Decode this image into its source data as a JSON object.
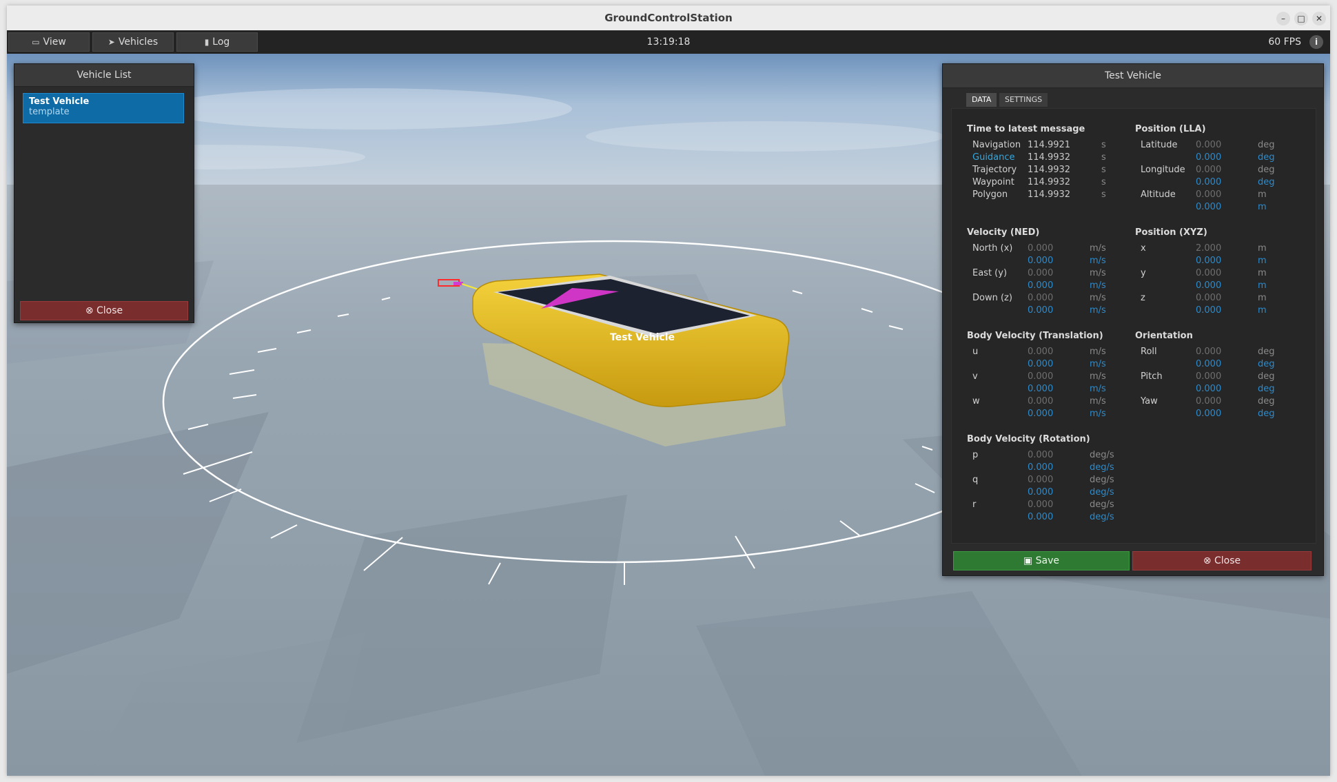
{
  "window": {
    "title": "GroundControlStation"
  },
  "menubar": {
    "view_label": "View",
    "vehicles_label": "Vehicles",
    "log_label": "Log",
    "clock": "13:19:18",
    "fps": "60 FPS"
  },
  "scene": {
    "vehicle_label": "Test Vehicle"
  },
  "vehicle_list": {
    "title": "Vehicle List",
    "items": [
      {
        "name": "Test Vehicle",
        "type": "template"
      }
    ],
    "close_label": "Close"
  },
  "vehicle_panel": {
    "title": "Test Vehicle",
    "tabs": [
      {
        "label": "DATA",
        "active": true
      },
      {
        "label": "SETTINGS",
        "active": false
      }
    ],
    "save_label": "Save",
    "close_label": "Close",
    "latest_message": {
      "title": "Time to latest message",
      "rows": [
        {
          "label": "Navigation",
          "value": "114.9921",
          "unit": "s"
        },
        {
          "label": "Guidance",
          "value": "114.9932",
          "unit": "s"
        },
        {
          "label": "Trajectory",
          "value": "114.9932",
          "unit": "s"
        },
        {
          "label": "Waypoint",
          "value": "114.9932",
          "unit": "s"
        },
        {
          "label": "Polygon",
          "value": "114.9932",
          "unit": "s"
        }
      ]
    },
    "position_lla": {
      "title": "Position (LLA)",
      "rows": [
        {
          "label": "Latitude",
          "value": "0.000",
          "unit": "deg",
          "target": "0.000",
          "target_unit": "deg"
        },
        {
          "label": "Longitude",
          "value": "0.000",
          "unit": "deg",
          "target": "0.000",
          "target_unit": "deg"
        },
        {
          "label": "Altitude",
          "value": "0.000",
          "unit": "m",
          "target": "0.000",
          "target_unit": "m"
        }
      ]
    },
    "velocity_ned": {
      "title": "Velocity (NED)",
      "rows": [
        {
          "label": "North (x)",
          "value": "0.000",
          "unit": "m/s",
          "target": "0.000",
          "target_unit": "m/s"
        },
        {
          "label": "East (y)",
          "value": "0.000",
          "unit": "m/s",
          "target": "0.000",
          "target_unit": "m/s"
        },
        {
          "label": "Down (z)",
          "value": "0.000",
          "unit": "m/s",
          "target": "0.000",
          "target_unit": "m/s"
        }
      ]
    },
    "position_xyz": {
      "title": "Position (XYZ)",
      "rows": [
        {
          "label": "x",
          "value": "2.000",
          "unit": "m",
          "target": "0.000",
          "target_unit": "m"
        },
        {
          "label": "y",
          "value": "0.000",
          "unit": "m",
          "target": "0.000",
          "target_unit": "m"
        },
        {
          "label": "z",
          "value": "0.000",
          "unit": "m",
          "target": "0.000",
          "target_unit": "m"
        }
      ]
    },
    "body_velocity_translation": {
      "title": "Body Velocity (Translation)",
      "rows": [
        {
          "label": "u",
          "value": "0.000",
          "unit": "m/s",
          "target": "0.000",
          "target_unit": "m/s"
        },
        {
          "label": "v",
          "value": "0.000",
          "unit": "m/s",
          "target": "0.000",
          "target_unit": "m/s"
        },
        {
          "label": "w",
          "value": "0.000",
          "unit": "m/s",
          "target": "0.000",
          "target_unit": "m/s"
        }
      ]
    },
    "orientation": {
      "title": "Orientation",
      "rows": [
        {
          "label": "Roll",
          "value": "0.000",
          "unit": "deg",
          "target": "0.000",
          "target_unit": "deg"
        },
        {
          "label": "Pitch",
          "value": "0.000",
          "unit": "deg",
          "target": "0.000",
          "target_unit": "deg"
        },
        {
          "label": "Yaw",
          "value": "0.000",
          "unit": "deg",
          "target": "0.000",
          "target_unit": "deg"
        }
      ]
    },
    "body_velocity_rotation": {
      "title": "Body Velocity (Rotation)",
      "rows": [
        {
          "label": "p",
          "value": "0.000",
          "unit": "deg/s",
          "target": "0.000",
          "target_unit": "deg/s"
        },
        {
          "label": "q",
          "value": "0.000",
          "unit": "deg/s",
          "target": "0.000",
          "target_unit": "deg/s"
        },
        {
          "label": "r",
          "value": "0.000",
          "unit": "deg/s",
          "target": "0.000",
          "target_unit": "deg/s"
        }
      ]
    }
  }
}
